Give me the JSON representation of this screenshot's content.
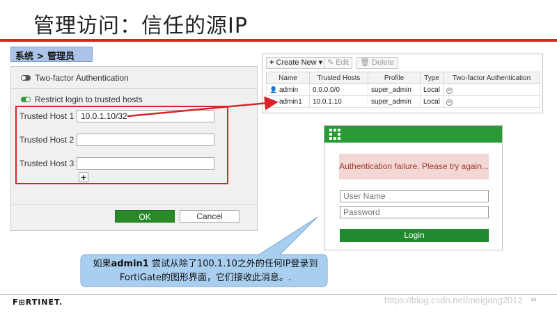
{
  "slide": {
    "title": "管理访问：信任的源IP",
    "breadcrumb": "系统 > 管理员"
  },
  "admin_settings": {
    "two_factor_label": "Two-factor Authentication",
    "two_factor_enabled": false,
    "restrict_label": "Restrict login to trusted hosts",
    "restrict_enabled": true,
    "hosts": [
      {
        "label": "Trusted Host 1",
        "value": "10.0.1.10/32"
      },
      {
        "label": "Trusted Host 2",
        "value": ""
      },
      {
        "label": "Trusted Host 3",
        "value": ""
      }
    ],
    "add_symbol": "+",
    "ok_label": "OK",
    "cancel_label": "Cancel"
  },
  "admin_table": {
    "toolbar": {
      "create": "Create New",
      "edit": "Edit",
      "delete": "Delete"
    },
    "columns": [
      "Name",
      "Trusted Hosts",
      "Profile",
      "Type",
      "Two-factor Authentication"
    ],
    "rows": [
      {
        "name": "admin",
        "hosts": "0.0.0.0/0",
        "profile": "super_admin",
        "type": "Local"
      },
      {
        "name": "admin1",
        "hosts": "10.0.1.10",
        "profile": "super_admin",
        "type": "Local"
      }
    ]
  },
  "login": {
    "error": "Authentication failure. Please try again...",
    "username_placeholder": "User Name",
    "password_placeholder": "Password",
    "button": "Login"
  },
  "callout": {
    "prefix": "如果",
    "bold": "admin1",
    "rest_line1": " 尝试从除了100.1.10之外的任何IP登录到",
    "line2": "FortiGate的图形界面，它们接收此消息。."
  },
  "footer": {
    "logo": "F⊞RTINET.",
    "page_number": "13",
    "watermark": "https://blog.csdn.net/meigang2012"
  },
  "colors": {
    "accent_red": "#d9241b",
    "fortinet_green": "#2a9a36",
    "callout_blue": "#a9cff0"
  }
}
